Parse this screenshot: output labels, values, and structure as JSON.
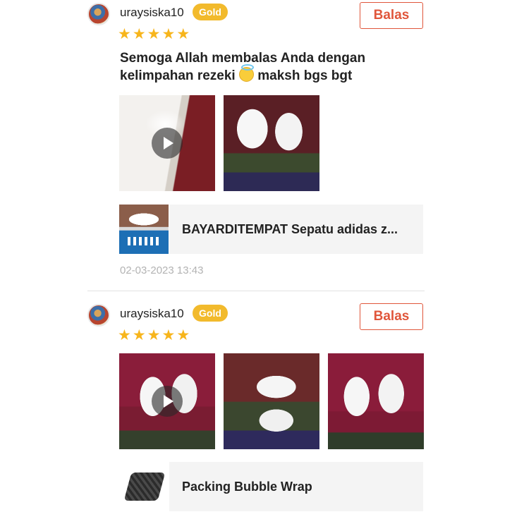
{
  "reviews": [
    {
      "username": "uraysiska10",
      "badge": "Gold",
      "reply_label": "Balas",
      "rating": 5,
      "comment_part1": "Semoga Allah membalas Anda dengan kelimpahan rezeki ",
      "comment_part2": " maksh bgs bgt",
      "product_name": "BAYARDITEMPAT Sepatu adidas z...",
      "timestamp": "02-03-2023 13:43"
    },
    {
      "username": "uraysiska10",
      "badge": "Gold",
      "reply_label": "Balas",
      "rating": 5,
      "product_name": "Packing Bubble Wrap"
    }
  ],
  "colors": {
    "accent": "#e0563b",
    "badge": "#f2ba2c",
    "star": "#f7b51c",
    "timestamp": "#b3b3b3"
  },
  "icons": {
    "star": "★",
    "play": "play-icon"
  }
}
